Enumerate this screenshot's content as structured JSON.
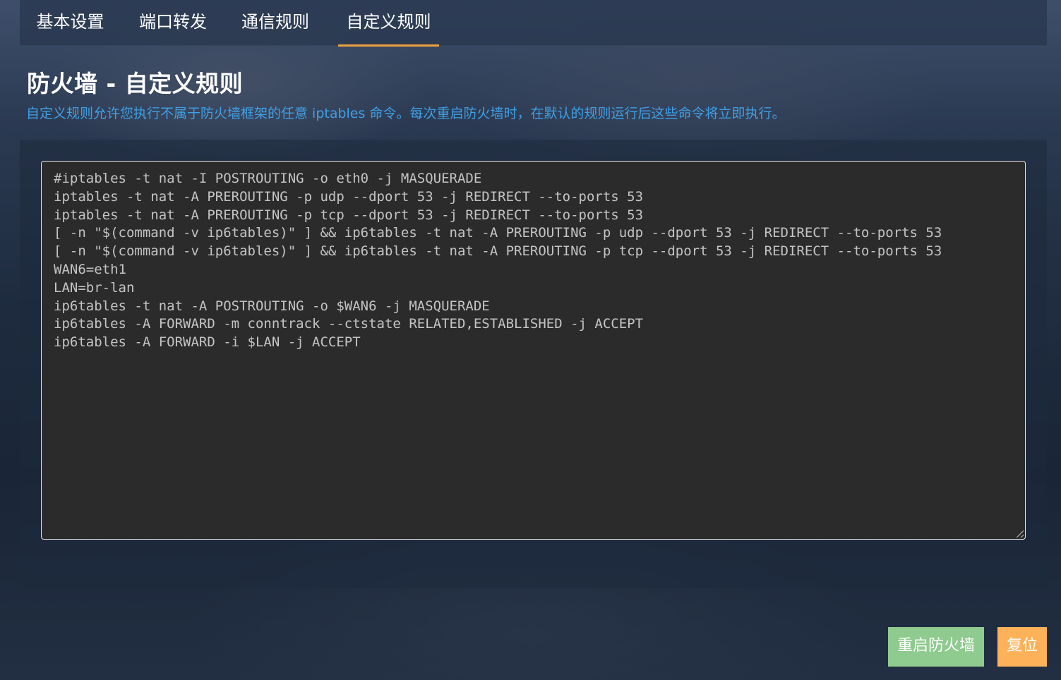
{
  "tabs": [
    {
      "label": "基本设置",
      "active": false
    },
    {
      "label": "端口转发",
      "active": false
    },
    {
      "label": "通信规则",
      "active": false
    },
    {
      "label": "自定义规则",
      "active": true
    }
  ],
  "page": {
    "title": "防火墙 - 自定义规则",
    "description": "自定义规则允许您执行不属于防火墙框架的任意 iptables 命令。每次重启防火墙时，在默认的规则运行后这些命令将立即执行。"
  },
  "editor": {
    "lines": [
      "#iptables -t nat -I POSTROUTING -o eth0 -j MASQUERADE",
      "iptables -t nat -A PREROUTING -p udp --dport 53 -j REDIRECT --to-ports 53",
      "iptables -t nat -A PREROUTING -p tcp --dport 53 -j REDIRECT --to-ports 53",
      "[ -n \"$(command -v ip6tables)\" ] && ip6tables -t nat -A PREROUTING -p udp --dport 53 -j REDIRECT --to-ports 53",
      "[ -n \"$(command -v ip6tables)\" ] && ip6tables -t nat -A PREROUTING -p tcp --dport 53 -j REDIRECT --to-ports 53",
      "WAN6=eth1",
      "LAN=br-lan",
      "ip6tables -t nat -A POSTROUTING -o $WAN6 -j MASQUERADE",
      "ip6tables -A FORWARD -m conntrack --ctstate RELATED,ESTABLISHED -j ACCEPT",
      "ip6tables -A FORWARD -i $LAN -j ACCEPT"
    ]
  },
  "actions": {
    "restart_label": "重启防火墙",
    "reset_label": "复位"
  },
  "colors": {
    "accent_tab": "#f0a03c",
    "description": "#3fa0e6",
    "restart_button": "#8fca8f",
    "reset_button": "#fdb25a",
    "editor_bg": "#2b2b2b"
  }
}
